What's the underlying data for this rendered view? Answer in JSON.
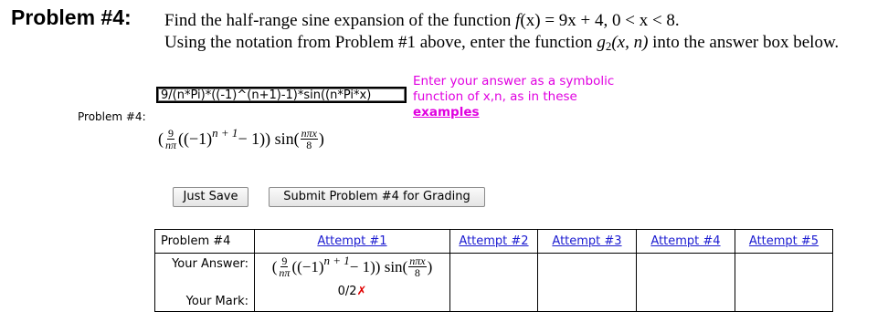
{
  "problem": {
    "title": "Problem #4:",
    "line1_pre": "Find the half-range sine expansion of the function ",
    "line1_f": "f",
    "line1_fx": "(x)",
    "line1_eq": " = 9x + 4,  0 < x < 8.",
    "line2_pre": "Using the notation from Problem #1 above, enter the function ",
    "line2_g": "g",
    "line2_sub": "2",
    "line2_args": "(x, n)",
    "line2_post": " into the answer box below."
  },
  "answer": {
    "row_label": "Problem #4:",
    "input_value": "9/(n*Pi)*((-1)^(n+1)-1)*sin((n*Pi*x)",
    "hint_line1": "Enter your answer as a symbolic",
    "hint_line2": "function of x,n, as in these",
    "hint_link": "examples",
    "preview": {
      "open": "(",
      "frac_num": "9",
      "frac_den": "nπ",
      "mid": "((−1)",
      "sup": "n + 1",
      "tail": " − 1)) sin(",
      "frac2_num": "nπx",
      "frac2_den": "8",
      "close": ")"
    }
  },
  "buttons": {
    "save": "Just Save",
    "submit": "Submit Problem #4 for Grading"
  },
  "attempts_table": {
    "header": "Problem #4",
    "attempts": [
      "Attempt #1",
      "Attempt #2",
      "Attempt #3",
      "Attempt #4",
      "Attempt #5"
    ],
    "your_answer_label": "Your Answer:",
    "your_mark_label": "Your Mark:",
    "mark_value": "0/2",
    "mark_symbol": "✗"
  },
  "colors": {
    "hint": "#e000e0",
    "link": "#1a1ad0",
    "wrong": "#e00000"
  }
}
